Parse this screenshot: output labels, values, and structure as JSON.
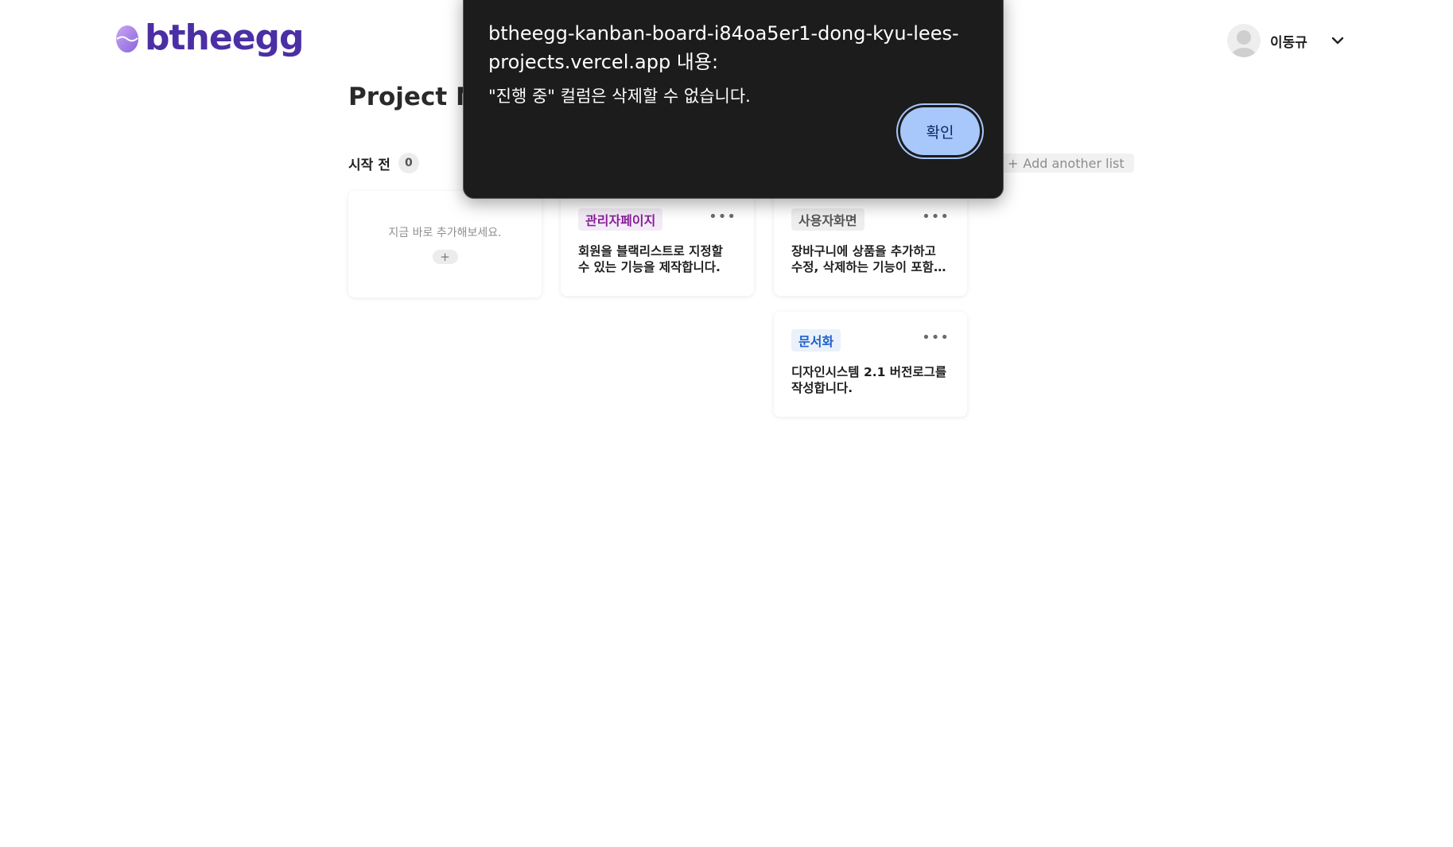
{
  "header": {
    "logo_text": "btheegg",
    "user_name": "이동규"
  },
  "project": {
    "title": "Project No"
  },
  "board": {
    "columns": [
      {
        "title": "시작 전",
        "count": "0",
        "empty_text": "지금 바로 추가해보세요.",
        "add_label": "+"
      }
    ],
    "add_list_label": "Add another list",
    "cards": [
      {
        "tag": "관리자페이지",
        "description": "회원을 블랙리스트로 지정할 수 있는 기능을 제작합니다.",
        "more": "•••"
      },
      {
        "tag": "사용자화면",
        "description": "장바구니에 상품을 추가하고 수정, 삭제하는 기능이 포함됩니다.",
        "more": "•••"
      },
      {
        "tag": "문서화",
        "description": "디자인시스템 2.1 버전로그를 작성합니다.",
        "more": "•••"
      }
    ]
  },
  "dialog": {
    "title": "btheegg-kanban-board-i84oa5er1-dong-kyu-lees-projects.vercel.app 내용:",
    "message": "\"진행 중\" 컬럼은 삭제할 수 없습니다.",
    "confirm_label": "확인"
  },
  "colors": {
    "brand": "#4b2fa4",
    "dialog_bg": "#1c1c1c",
    "confirm_bg": "#a8c7fa"
  }
}
